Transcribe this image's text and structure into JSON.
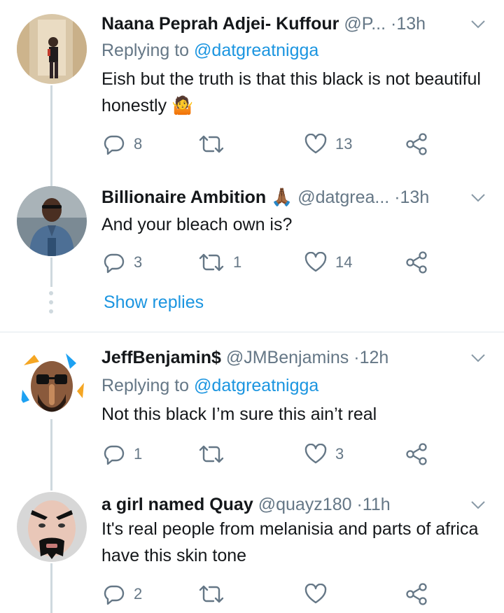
{
  "tweets": [
    {
      "name": "Naana Peprah Adjei- Kuffour",
      "handle": "@P...",
      "sep": "·",
      "time": "13h",
      "reply_prefix": "Replying to",
      "reply_mention": "@datgreatnigga",
      "text": "Eish but the truth is that this black is not beautiful honestly 🤷",
      "replies": "8",
      "retweets": "",
      "likes": "13"
    },
    {
      "name": "Billionaire Ambition 🙏🏾",
      "handle": "@datgrea...",
      "sep": "·",
      "time": "13h",
      "text": "And your bleach own is?",
      "replies": "3",
      "retweets": "1",
      "likes": "14"
    },
    {
      "name": "JeffBenjamin$",
      "handle": "@JMBenjamins",
      "sep": "·",
      "time": "12h",
      "reply_prefix": "Replying to",
      "reply_mention": "@datgreatnigga",
      "text": "Not this black I’m sure this ain’t real",
      "replies": "1",
      "retweets": "",
      "likes": "3"
    },
    {
      "name": "a girl named Quay",
      "handle": "@quayz180",
      "sep": "·",
      "time": "11h",
      "text": "It's real people from melanisia and parts of africa have this skin tone",
      "replies": "2",
      "retweets": "",
      "likes": ""
    }
  ],
  "show_replies_label": "Show replies",
  "colors": {
    "accent": "#1b95e0",
    "muted": "#657786",
    "line": "#cfd9de"
  },
  "icons": [
    "reply-icon",
    "retweet-icon",
    "like-icon",
    "share-icon",
    "chevron-down-icon"
  ]
}
